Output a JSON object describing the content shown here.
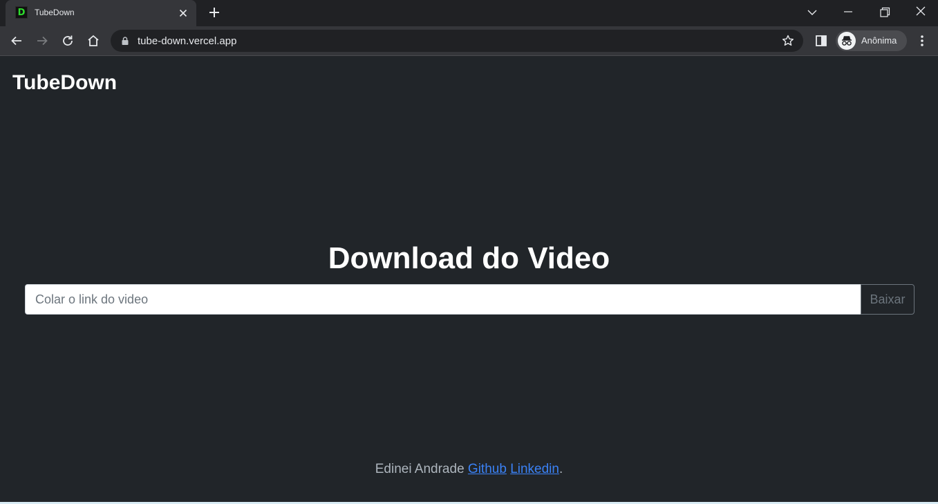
{
  "browser": {
    "tab": {
      "favicon_letter": "D",
      "title": "TubeDown"
    },
    "url": "tube-down.vercel.app",
    "profile_label": "Anônima"
  },
  "page": {
    "brand": "TubeDown",
    "heading": "Download do Video",
    "input": {
      "value": "",
      "placeholder": "Colar o link do video"
    },
    "download_button": "Baixar",
    "footer": {
      "author": "Edinei Andrade",
      "github_link": "Github",
      "linkedin_link": "Linkedin",
      "trailing": "."
    }
  },
  "colors": {
    "page_background": "#212529",
    "link": "#3b82f6",
    "favicon_letter": "#2ddc2d"
  },
  "icons": [
    "tab-close-icon",
    "new-tab-icon",
    "tab-search-icon",
    "minimize-icon",
    "restore-icon",
    "window-close-icon",
    "back-icon",
    "forward-icon",
    "reload-icon",
    "home-icon",
    "lock-icon",
    "bookmark-star-icon",
    "side-panel-icon",
    "incognito-icon",
    "more-menu-icon"
  ]
}
